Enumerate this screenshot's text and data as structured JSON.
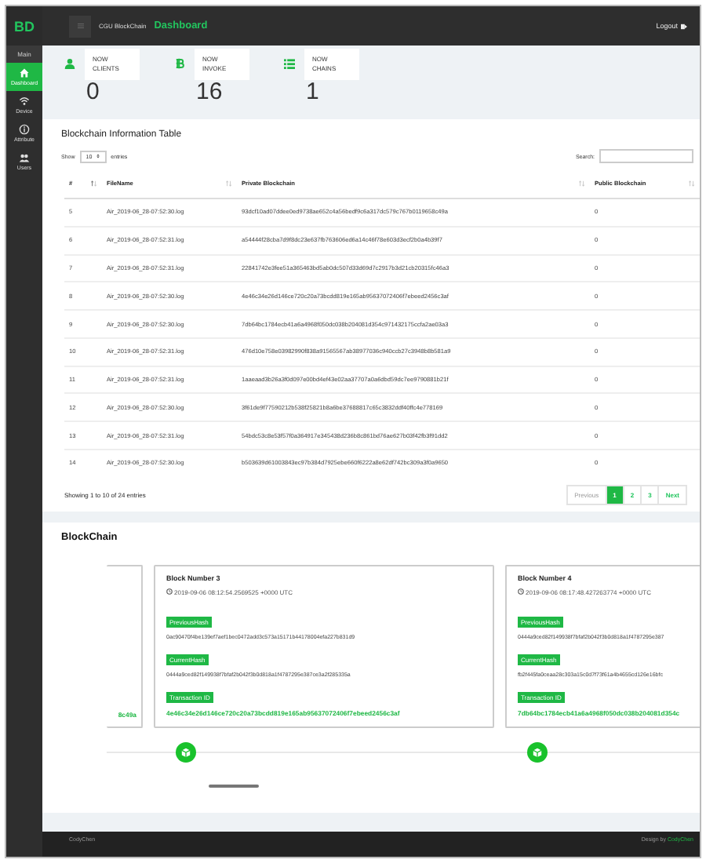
{
  "brand": "BD",
  "sidebar": {
    "section": "Main",
    "items": [
      {
        "label": "Dashboard",
        "kind": "home",
        "selected": true
      },
      {
        "label": "Device",
        "kind": "wifi",
        "selected": false
      },
      {
        "label": "Attribute",
        "kind": "info",
        "selected": false
      },
      {
        "label": "Users",
        "kind": "users",
        "selected": false
      }
    ]
  },
  "header": {
    "app": "CGU BlockChain",
    "page": "Dashboard",
    "logout": "Logout"
  },
  "stats": [
    {
      "label": "NOW CLIENTS",
      "value": "0",
      "kind": "user"
    },
    {
      "label": "NOW INVOKE",
      "value": "16",
      "kind": "coin"
    },
    {
      "label": "NOW CHAINS",
      "value": "1",
      "kind": "list"
    }
  ],
  "table": {
    "title": "Blockchain Information Table",
    "show": "Show",
    "length": "10",
    "entries": "entries",
    "search": "Search:",
    "columns": [
      {
        "label": "#",
        "sorted": true
      },
      {
        "label": "FileName",
        "sorted": false
      },
      {
        "label": "Private Blockchain",
        "sorted": false
      },
      {
        "label": "Public Blockchain",
        "sorted": false
      }
    ],
    "rows": [
      [
        "5",
        "Air_2019-06_28-07:52:30.log",
        "93dcf10ad07ddee0ed9738ae652c4a56bedf9c6a317dc579c767b0119658c49a",
        "0"
      ],
      [
        "6",
        "Air_2019-06_28-07:52:31.log",
        "a54444f28cba7d9f8dc23e637fb763606ed6a14c46f78e603d3ecf2b0a4b39f7",
        "0"
      ],
      [
        "7",
        "Air_2019-06_28-07:52:31.log",
        "22841742e3fee51a365463bd5ab0dc507d33d69d7c2917b3d21cb20315fc46a3",
        "0"
      ],
      [
        "8",
        "Air_2019-06_28-07:52:30.log",
        "4e46c34e26d146ce720c20a73bcdd819e165ab95637072406f7ebeed2456c3af",
        "0"
      ],
      [
        "9",
        "Air_2019-06_28-07:52:30.log",
        "7db64bc1784ecb41a6a4968f050dc038b204081d354c971432175ccfa2ae03a3",
        "0"
      ],
      [
        "10",
        "Air_2019-06_28-07:52:31.log",
        "476d10e758e03982990f838a91565567ab38977036c940ccb27c3948b8b581a9",
        "0"
      ],
      [
        "11",
        "Air_2019-06_28-07:52:31.log",
        "1aaeaad3b26a3f0d097e00bd4ef43e02aa37707a0a6dbd59dc7ee9790881b21f",
        "0"
      ],
      [
        "12",
        "Air_2019-06_28-07:52:30.log",
        "3f61de9f77590212b538f25821b8a6be37688817c65c3832ddf40ffc4e778169",
        "0"
      ],
      [
        "13",
        "Air_2019-06_28-07:52:31.log",
        "54bdc53c8e53f57f0a364917e345438d236b8c861bd76ae627b03f42fb3f91dd2",
        "0"
      ],
      [
        "14",
        "Air_2019-06_28-07:52:30.log",
        "b503639d61003843ec97b384d7925ebe660f6222a8e62df742bc309a3f0a9650",
        "0"
      ]
    ],
    "info": "Showing 1 to 10 of 24 entries",
    "pages": [
      {
        "label": "Previous",
        "selected": false
      },
      {
        "label": "1",
        "selected": true
      },
      {
        "label": "2",
        "selected": false
      },
      {
        "label": "3",
        "selected": false
      },
      {
        "label": "Next",
        "selected": false
      }
    ]
  },
  "blockchain": {
    "title": "BlockChain",
    "partial_tail": "8c49a",
    "blocks": [
      {
        "title": "Block Number 3",
        "time": "2019-09-06 08:12:54.2569525 +0000 UTC",
        "fields": [
          {
            "label": "PreviousHash",
            "value": "0ac90470f4be139ef7aef1bec0472add3c573a15171b44178004efa227b831d9",
            "kind": "hash"
          },
          {
            "label": "CurrentHash",
            "value": "0444a9ced82f149938f7bfaf2b042f3b0d818a1f4787295e387ce3a2f285335a",
            "kind": "hash"
          },
          {
            "label": "Transaction ID",
            "value": "4e46c34e26d146ce720c20a73bcdd819e165ab95637072406f7ebeed2456c3af",
            "kind": "transaction"
          }
        ]
      },
      {
        "title": "Block Number 4",
        "time": "2019-09-06 08:17:48.427263774 +0000 UTC",
        "fields": [
          {
            "label": "PreviousHash",
            "value": "0444a9ced82f149938f7bfaf2b042f3b0d818a1f4787295e387",
            "kind": "hash"
          },
          {
            "label": "CurrentHash",
            "value": "fb2f445fa0ceaa28c303a15c0d7f73f61a4b4655cd126e16bfc",
            "kind": "hash"
          },
          {
            "label": "Transaction ID",
            "value": "7db64bc1784ecb41a6a4968f050dc038b204081d354c",
            "kind": "transaction"
          }
        ]
      }
    ]
  },
  "footer": {
    "left": "CodyChen",
    "credit": "Design by **CodyChen**"
  }
}
